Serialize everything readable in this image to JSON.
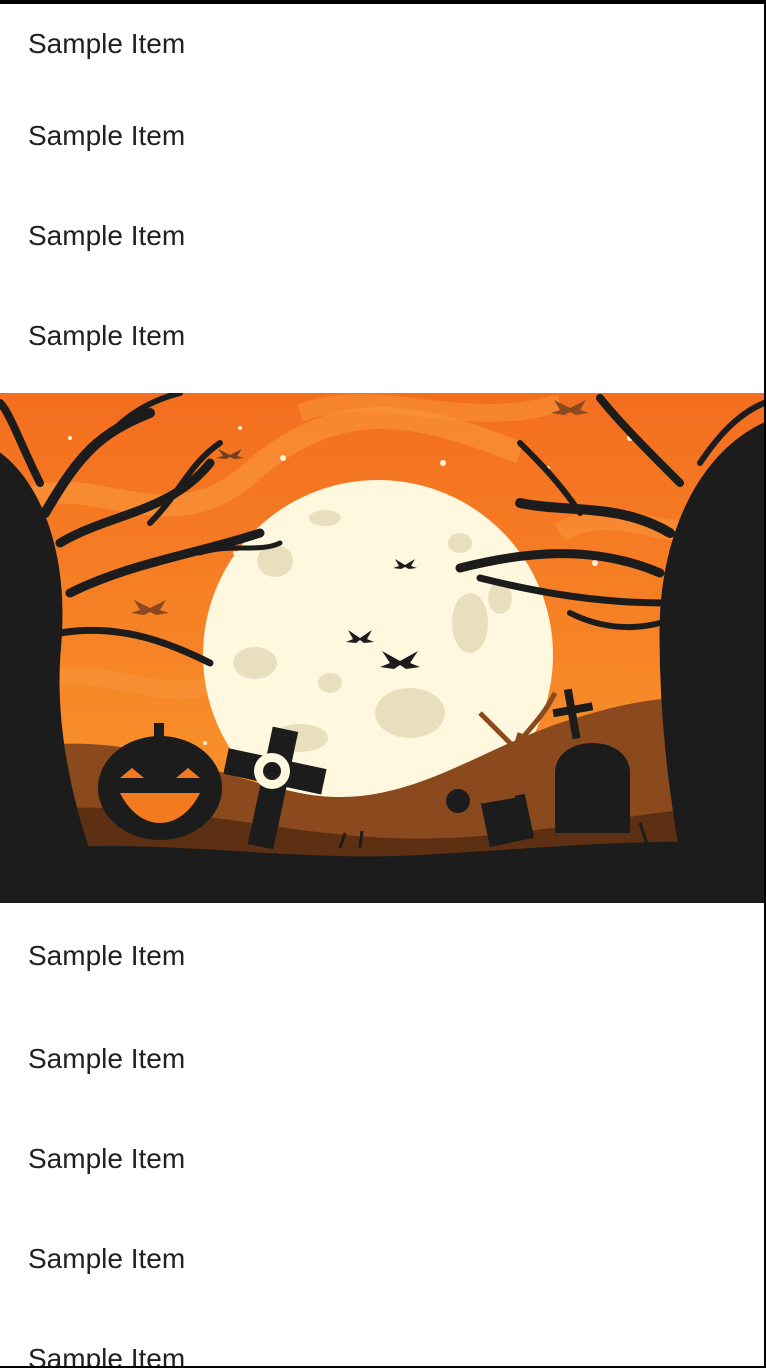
{
  "list_top": {
    "items": [
      "Sample Item",
      "Sample Item",
      "Sample Item",
      "Sample Item"
    ]
  },
  "banner": {
    "icon": "halloween-scene-image"
  },
  "list_bottom": {
    "items": [
      "Sample Item",
      "Sample Item",
      "Sample Item",
      "Sample Item",
      "Sample Item"
    ]
  },
  "colors": {
    "sky": "#F47A20",
    "sky_light": "#F9A13A",
    "moon": "#FFF8DF",
    "moon_spot": "#E8DFBF",
    "silhouette": "#1C1C1C",
    "hill": "#8A4A1E",
    "text": "#212121"
  }
}
